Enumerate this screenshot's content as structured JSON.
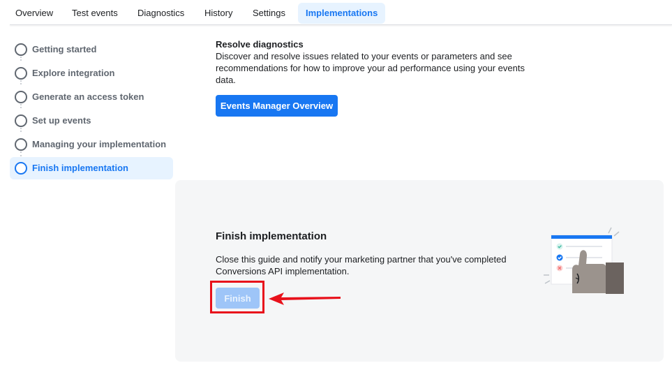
{
  "tabs": [
    {
      "label": "Overview"
    },
    {
      "label": "Test events"
    },
    {
      "label": "Diagnostics"
    },
    {
      "label": "History"
    },
    {
      "label": "Settings"
    },
    {
      "label": "Implementations"
    }
  ],
  "active_tab": "Implementations",
  "sidebar": {
    "steps": [
      {
        "label": "Getting started"
      },
      {
        "label": "Explore integration"
      },
      {
        "label": "Generate an access token"
      },
      {
        "label": "Set up events"
      },
      {
        "label": "Managing your implementation"
      },
      {
        "label": "Finish implementation"
      }
    ],
    "active_step": "Finish implementation"
  },
  "resolve": {
    "title": "Resolve diagnostics",
    "description": "Discover and resolve issues related to your events or parameters and see recommendations for how to improve your ad performance using your events data.",
    "button_label": "Events Manager Overview"
  },
  "finish": {
    "title": "Finish implementation",
    "description": "Close this guide and notify your marketing partner that you've completed Conversions API implementation.",
    "button_label": "Finish"
  },
  "colors": {
    "accent": "#1877f2",
    "active_bg": "#e7f3ff",
    "annotation_red": "#e8111b",
    "panel_bg": "#f5f6f7"
  },
  "icons": {
    "step_marker": "circle-outline-icon",
    "illustration": "thumbs-up-checklist-illustration",
    "annotation": "red-arrow-annotation"
  }
}
